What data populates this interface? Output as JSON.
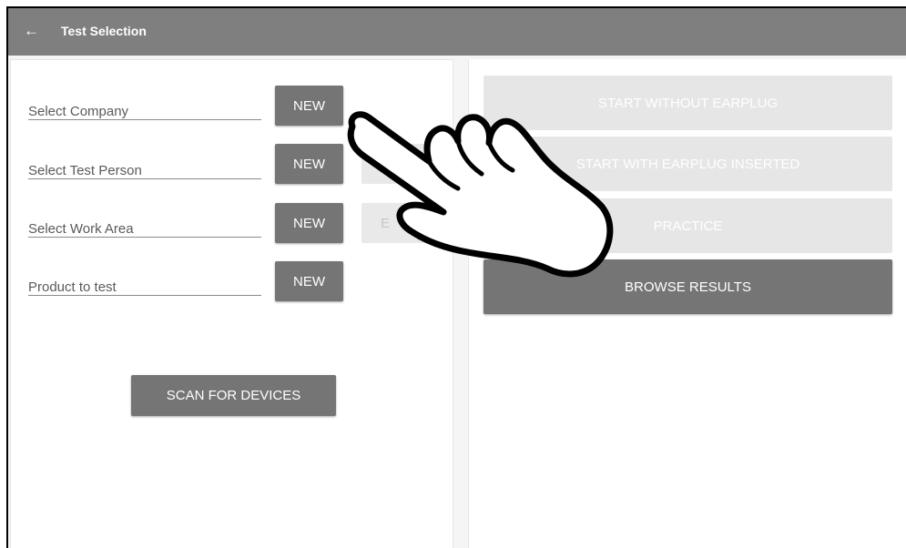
{
  "appbar": {
    "back_icon": "arrow-left-icon",
    "back_glyph": "←",
    "title": "Test Selection"
  },
  "left": {
    "fields": [
      {
        "label": "Select Company",
        "new_label": "NEW",
        "edit_label": ""
      },
      {
        "label": "Select Test Person",
        "new_label": "NEW",
        "edit_label": ""
      },
      {
        "label": "Select Work Area",
        "new_label": "NEW",
        "edit_label": "E"
      },
      {
        "label": "Product to test",
        "new_label": "NEW",
        "edit_label": ""
      }
    ],
    "scan_label": "SCAN FOR DEVICES"
  },
  "right": {
    "start_without": "START WITHOUT EARPLUG",
    "start_with": "START WITH EARPLUG INSERTED",
    "practice": "PRACTICE",
    "browse": "BROWSE RESULTS"
  },
  "overlay": {
    "icon": "pointing-hand-icon"
  },
  "colors": {
    "appbar": "#7f7f7f",
    "button": "#757575",
    "button_disabled": "#e6e6e6",
    "background": "#f5f5f5"
  }
}
